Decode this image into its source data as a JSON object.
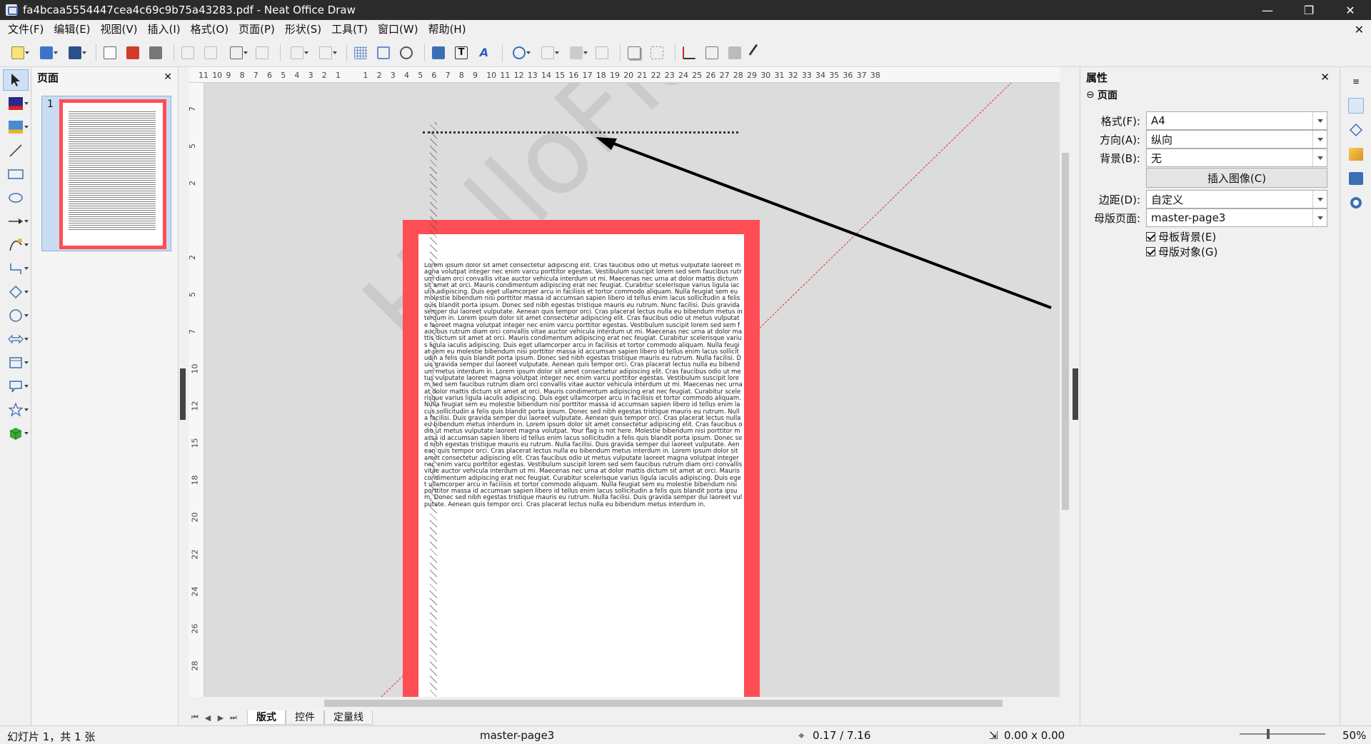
{
  "window": {
    "title": "fa4bcaa5554447cea4c69c9b75a43283.pdf - Neat Office Draw",
    "minimize": "—",
    "restore": "❐",
    "close": "✕"
  },
  "menu": {
    "items": [
      "文件(F)",
      "编辑(E)",
      "视图(V)",
      "插入(I)",
      "格式(O)",
      "页面(P)",
      "形状(S)",
      "工具(T)",
      "窗口(W)",
      "帮助(H)"
    ],
    "close_doc": "✕"
  },
  "pages_panel": {
    "title": "页面",
    "close": "✕",
    "thumbnail_number": "1"
  },
  "ruler": {
    "h_ticks": [
      "11",
      "10",
      "9",
      "8",
      "7",
      "6",
      "5",
      "4",
      "3",
      "2",
      "1",
      "",
      "1",
      "2",
      "3",
      "4",
      "5",
      "6",
      "7",
      "8",
      "9",
      "10",
      "11",
      "12",
      "13",
      "14",
      "15",
      "16",
      "17",
      "18",
      "19",
      "20",
      "21",
      "22",
      "23",
      "24",
      "25",
      "26",
      "27",
      "28",
      "29",
      "30",
      "31",
      "32",
      "33",
      "34",
      "35",
      "36",
      "37",
      "38"
    ],
    "v_ticks": [
      "7",
      "5",
      "2",
      "",
      "2",
      "5",
      "7",
      "10",
      "12",
      "15",
      "18",
      "20",
      "22",
      "24",
      "26",
      "28"
    ]
  },
  "canvas": {
    "watermark": "HelloFlagHe",
    "page_text": "Lorem ipsum dolor sit amet consectetur adipiscing elit. Cras faucibus odio ut metus vulputate laoreet magna volutpat integer nec enim varcu porttitor egestas. Vestibulum suscipit lorem sed sem faucibus rutrum diam orci convallis vitae auctor vehicula interdum ut mi. Maecenas nec urna at dolor mattis dictum sit amet at orci. Mauris condimentum adipiscing erat nec feugiat. Curabitur scelerisque varius ligula iaculis adipiscing. Duis eget ullamcorper arcu in facilisis et tortor commodo aliquam. Nulla feugiat sem eu molestie bibendum nisi porttitor massa id accumsan sapien libero id tellus enim lacus sollicitudin a felis quis blandit porta ipsum. Donec sed nibh egestas tristique mauris eu rutrum. Nunc facilisi. Duis gravida semper dui laoreet vulputate. Aenean quis tempor orci. Cras placerat lectus nulla eu bibendum metus interdum in. Lorem ipsum dolor sit amet consectetur adipiscing elit. Cras faucibus odio ut metus vulputate laoreet magna volutpat integer nec enim varcu porttitor egestas. Vestibulum suscipit lorem sed sem faucibus rutrum diam orci convallis vitae auctor vehicula interdum ut mi. Maecenas nec urna at dolor mattis dictum sit amet at orci. Mauris condimentum adipiscing erat nec feugiat. Curabitur scelerisque varius ligula iaculis adipiscing. Duis eget ullamcorper arcu in facilisis et tortor commodo aliquam. Nulla feugiat sem eu molestie bibendum nisi porttitor massa id accumsan sapien libero id tellus enim lacus sollicitudin a felis quis blandit porta ipsum. Donec sed nibh egestas tristique mauris eu rutrum. Nulla facilisi. Duis gravida semper dui laoreet vulputate. Aenean quis tempor orci. Cras placerat lectus nulla eu bibendum metus interdum in. Lorem ipsum dolor sit amet consectetur adipiscing elit. Cras faucibus odio ut metus vulputate laoreet magna volutpat integer nec enim varcu porttitor egestas. Vestibulum suscipit lorem sed sem faucibus rutrum diam orci convallis vitae auctor vehicula interdum ut mi. Maecenas nec urna at dolor mattis dictum sit amet at orci. Mauris condimentum adipiscing erat nec feugiat. Curabitur scelerisque varius ligula iaculis adipiscing. Duis eget ullamcorper arcu in facilisis et tortor commodo aliquam. Nulla feugiat sem eu molestie bibendum nisi porttitor massa id accumsan sapien libero id tellus enim lacus sollicitudin a felis quis blandit porta ipsum. Donec sed nibh egestas tristique mauris eu rutrum. Nulla facilisi. Duis gravida semper dui laoreet vulputate. Aenean quis tempor orci. Cras placerat lectus nulla eu bibendum metus interdum in. Lorem ipsum dolor sit amet consectetur adipiscing elit. Cras faucibus odio ut metus vulputate laoreet magna volutpat. Your flag is not here. Molestie bibendum nisi porttitor massa id accumsan sapien libero id tellus enim lacus sollicitudin a felis quis blandit porta ipsum. Donec sed nibh egestas tristique mauris eu rutrum. Nulla facilisi. Duis gravida semper dui laoreet vulputate. Aenean quis tempor orci. Cras placerat lectus nulla eu bibendum metus interdum in. Lorem ipsum dolor sit amet consectetur adipiscing elit. Cras faucibus odio ut metus vulputate laoreet magna volutpat integer nec enim varcu porttitor egestas. Vestibulum suscipit lorem sed sem faucibus rutrum diam orci convallis vitae auctor vehicula interdum ut mi. Maecenas nec urna at dolor mattis dictum sit amet at orci. Mauris condimentum adipiscing erat nec feugiat. Curabitur scelerisque varius ligula iaculis adipiscing. Duis eget ullamcorper arcu in facilisis et tortor commodo aliquam. Nulla feugiat sem eu molestie bibendum nisi porttitor massa id accumsan sapien libero id tellus enim lacus sollicitudin a felis quis blandit porta ipsum. Donec sed nibh egestas tristique mauris eu rutrum. Nulla facilisi. Duis gravida semper dui laoreet vulputate. Aenean quis tempor orci. Cras placerat lectus nulla eu bibendum metus interdum in."
  },
  "tabs": {
    "items": [
      "版式",
      "控件",
      "定量线"
    ],
    "nav": [
      "⏮",
      "◀",
      "▶",
      "⏭"
    ]
  },
  "properties": {
    "title": "属性",
    "close": "✕",
    "section": "页面",
    "format_label": "格式(F):",
    "format_value": "A4",
    "orientation_label": "方向(A):",
    "orientation_value": "纵向",
    "background_label": "背景(B):",
    "background_value": "无",
    "insert_image": "插入图像(C)",
    "margin_label": "边距(D):",
    "margin_value": "自定义",
    "master_label": "母版页面:",
    "master_value": "master-page3",
    "master_bg": "母板背景(E)",
    "master_obj": "母版对象(G)"
  },
  "status": {
    "slide": "幻灯片 1，共 1 张",
    "master": "master-page3",
    "position": "0.17 / 7.16",
    "size": "0.00 x 0.00",
    "zoom": "50%"
  },
  "colors": {
    "page_border": "#ff4d55",
    "selection": "#c9dcf3",
    "arrow": "#000000"
  }
}
